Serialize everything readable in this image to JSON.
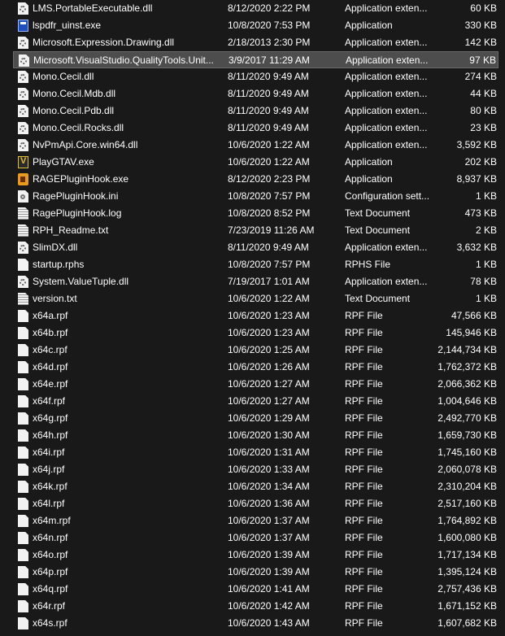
{
  "files": [
    {
      "name": "LMS.PortableExecutable.dll",
      "date": "8/12/2020 2:22 PM",
      "type": "Application exten...",
      "size": "60 KB",
      "icon": "dll-icon"
    },
    {
      "name": "lspdfr_uinst.exe",
      "date": "10/8/2020 7:53 PM",
      "type": "Application",
      "size": "330 KB",
      "icon": "app-icon"
    },
    {
      "name": "Microsoft.Expression.Drawing.dll",
      "date": "2/18/2013 2:30 PM",
      "type": "Application exten...",
      "size": "142 KB",
      "icon": "dll-icon"
    },
    {
      "name": "Microsoft.VisualStudio.QualityTools.Unit...",
      "date": "3/9/2017 11:29 AM",
      "type": "Application exten...",
      "size": "97 KB",
      "icon": "dll-icon",
      "selected": true
    },
    {
      "name": "Mono.Cecil.dll",
      "date": "8/11/2020 9:49 AM",
      "type": "Application exten...",
      "size": "274 KB",
      "icon": "dll-icon"
    },
    {
      "name": "Mono.Cecil.Mdb.dll",
      "date": "8/11/2020 9:49 AM",
      "type": "Application exten...",
      "size": "44 KB",
      "icon": "dll-icon"
    },
    {
      "name": "Mono.Cecil.Pdb.dll",
      "date": "8/11/2020 9:49 AM",
      "type": "Application exten...",
      "size": "80 KB",
      "icon": "dll-icon"
    },
    {
      "name": "Mono.Cecil.Rocks.dll",
      "date": "8/11/2020 9:49 AM",
      "type": "Application exten...",
      "size": "23 KB",
      "icon": "dll-icon"
    },
    {
      "name": "NvPmApi.Core.win64.dll",
      "date": "10/6/2020 1:22 AM",
      "type": "Application exten...",
      "size": "3,592 KB",
      "icon": "dll-icon"
    },
    {
      "name": "PlayGTAV.exe",
      "date": "10/6/2020 1:22 AM",
      "type": "Application",
      "size": "202 KB",
      "icon": "gtav-icon"
    },
    {
      "name": "RAGEPluginHook.exe",
      "date": "8/12/2020 2:23 PM",
      "type": "Application",
      "size": "8,937 KB",
      "icon": "rage-icon"
    },
    {
      "name": "RagePluginHook.ini",
      "date": "10/8/2020 7:57 PM",
      "type": "Configuration sett...",
      "size": "1 KB",
      "icon": "ini-icon"
    },
    {
      "name": "RagePluginHook.log",
      "date": "10/8/2020 8:52 PM",
      "type": "Text Document",
      "size": "473 KB",
      "icon": "text-doc-icon"
    },
    {
      "name": "RPH_Readme.txt",
      "date": "7/23/2019 11:26 AM",
      "type": "Text Document",
      "size": "2 KB",
      "icon": "text-doc-icon"
    },
    {
      "name": "SlimDX.dll",
      "date": "8/11/2020 9:49 AM",
      "type": "Application exten...",
      "size": "3,632 KB",
      "icon": "dll-icon"
    },
    {
      "name": "startup.rphs",
      "date": "10/8/2020 7:57 PM",
      "type": "RPHS File",
      "size": "1 KB",
      "icon": "file-icon"
    },
    {
      "name": "System.ValueTuple.dll",
      "date": "7/19/2017 1:01 AM",
      "type": "Application exten...",
      "size": "78 KB",
      "icon": "dll-icon"
    },
    {
      "name": "version.txt",
      "date": "10/6/2020 1:22 AM",
      "type": "Text Document",
      "size": "1 KB",
      "icon": "text-doc-icon"
    },
    {
      "name": "x64a.rpf",
      "date": "10/6/2020 1:23 AM",
      "type": "RPF File",
      "size": "47,566 KB",
      "icon": "file-icon"
    },
    {
      "name": "x64b.rpf",
      "date": "10/6/2020 1:23 AM",
      "type": "RPF File",
      "size": "145,946 KB",
      "icon": "file-icon"
    },
    {
      "name": "x64c.rpf",
      "date": "10/6/2020 1:25 AM",
      "type": "RPF File",
      "size": "2,144,734 KB",
      "icon": "file-icon"
    },
    {
      "name": "x64d.rpf",
      "date": "10/6/2020 1:26 AM",
      "type": "RPF File",
      "size": "1,762,372 KB",
      "icon": "file-icon"
    },
    {
      "name": "x64e.rpf",
      "date": "10/6/2020 1:27 AM",
      "type": "RPF File",
      "size": "2,066,362 KB",
      "icon": "file-icon"
    },
    {
      "name": "x64f.rpf",
      "date": "10/6/2020 1:27 AM",
      "type": "RPF File",
      "size": "1,004,646 KB",
      "icon": "file-icon"
    },
    {
      "name": "x64g.rpf",
      "date": "10/6/2020 1:29 AM",
      "type": "RPF File",
      "size": "2,492,770 KB",
      "icon": "file-icon"
    },
    {
      "name": "x64h.rpf",
      "date": "10/6/2020 1:30 AM",
      "type": "RPF File",
      "size": "1,659,730 KB",
      "icon": "file-icon"
    },
    {
      "name": "x64i.rpf",
      "date": "10/6/2020 1:31 AM",
      "type": "RPF File",
      "size": "1,745,160 KB",
      "icon": "file-icon"
    },
    {
      "name": "x64j.rpf",
      "date": "10/6/2020 1:33 AM",
      "type": "RPF File",
      "size": "2,060,078 KB",
      "icon": "file-icon"
    },
    {
      "name": "x64k.rpf",
      "date": "10/6/2020 1:34 AM",
      "type": "RPF File",
      "size": "2,310,204 KB",
      "icon": "file-icon"
    },
    {
      "name": "x64l.rpf",
      "date": "10/6/2020 1:36 AM",
      "type": "RPF File",
      "size": "2,517,160 KB",
      "icon": "file-icon"
    },
    {
      "name": "x64m.rpf",
      "date": "10/6/2020 1:37 AM",
      "type": "RPF File",
      "size": "1,764,892 KB",
      "icon": "file-icon"
    },
    {
      "name": "x64n.rpf",
      "date": "10/6/2020 1:37 AM",
      "type": "RPF File",
      "size": "1,600,080 KB",
      "icon": "file-icon"
    },
    {
      "name": "x64o.rpf",
      "date": "10/6/2020 1:39 AM",
      "type": "RPF File",
      "size": "1,717,134 KB",
      "icon": "file-icon"
    },
    {
      "name": "x64p.rpf",
      "date": "10/6/2020 1:39 AM",
      "type": "RPF File",
      "size": "1,395,124 KB",
      "icon": "file-icon"
    },
    {
      "name": "x64q.rpf",
      "date": "10/6/2020 1:41 AM",
      "type": "RPF File",
      "size": "2,757,436 KB",
      "icon": "file-icon"
    },
    {
      "name": "x64r.rpf",
      "date": "10/6/2020 1:42 AM",
      "type": "RPF File",
      "size": "1,671,152 KB",
      "icon": "file-icon"
    },
    {
      "name": "x64s.rpf",
      "date": "10/6/2020 1:43 AM",
      "type": "RPF File",
      "size": "1,607,682 KB",
      "icon": "file-icon"
    }
  ],
  "colors": {
    "background": "#191919",
    "text": "#ffffff",
    "selected_row": "#4d4d4d"
  }
}
